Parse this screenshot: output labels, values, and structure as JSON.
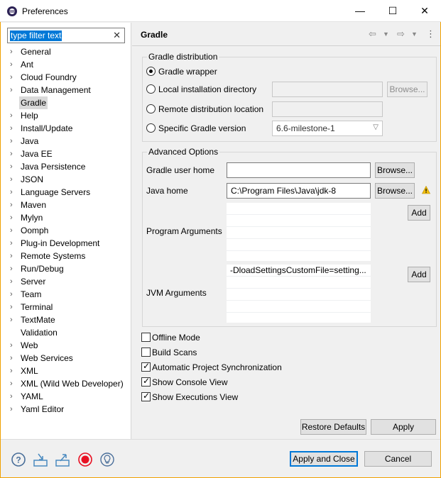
{
  "window": {
    "title": "Preferences",
    "min_glyph": "—",
    "max_glyph": "☐",
    "close_glyph": "✕"
  },
  "filter": {
    "value": "type filter text"
  },
  "tree": [
    {
      "label": "General",
      "expandable": true
    },
    {
      "label": "Ant",
      "expandable": true
    },
    {
      "label": "Cloud Foundry",
      "expandable": true
    },
    {
      "label": "Data Management",
      "expandable": true
    },
    {
      "label": "Gradle",
      "expandable": false,
      "selected": true
    },
    {
      "label": "Help",
      "expandable": true
    },
    {
      "label": "Install/Update",
      "expandable": true
    },
    {
      "label": "Java",
      "expandable": true
    },
    {
      "label": "Java EE",
      "expandable": true
    },
    {
      "label": "Java Persistence",
      "expandable": true
    },
    {
      "label": "JSON",
      "expandable": true
    },
    {
      "label": "Language Servers",
      "expandable": true
    },
    {
      "label": "Maven",
      "expandable": true
    },
    {
      "label": "Mylyn",
      "expandable": true
    },
    {
      "label": "Oomph",
      "expandable": true
    },
    {
      "label": "Plug-in Development",
      "expandable": true
    },
    {
      "label": "Remote Systems",
      "expandable": true
    },
    {
      "label": "Run/Debug",
      "expandable": true
    },
    {
      "label": "Server",
      "expandable": true
    },
    {
      "label": "Team",
      "expandable": true
    },
    {
      "label": "Terminal",
      "expandable": true
    },
    {
      "label": "TextMate",
      "expandable": true
    },
    {
      "label": "Validation",
      "expandable": false
    },
    {
      "label": "Web",
      "expandable": true
    },
    {
      "label": "Web Services",
      "expandable": true
    },
    {
      "label": "XML",
      "expandable": true
    },
    {
      "label": "XML (Wild Web Developer)",
      "expandable": true
    },
    {
      "label": "YAML",
      "expandable": true
    },
    {
      "label": "Yaml Editor",
      "expandable": true
    }
  ],
  "page": {
    "title": "Gradle",
    "distribution": {
      "title": "Gradle distribution",
      "options": [
        {
          "label": "Gradle wrapper",
          "selected": true
        },
        {
          "label": "Local installation directory",
          "selected": false
        },
        {
          "label": "Remote distribution location",
          "selected": false
        },
        {
          "label": "Specific Gradle version",
          "selected": false
        }
      ],
      "local_dir_value": "",
      "remote_value": "",
      "browse_label": "Browse...",
      "version_value": "6.6-milestone-1"
    },
    "advanced": {
      "title": "Advanced Options",
      "user_home_label": "Gradle user home",
      "user_home_value": "",
      "java_home_label": "Java home",
      "java_home_value": "C:\\Program Files\\Java\\jdk-8",
      "browse_label": "Browse...",
      "program_args_label": "Program Arguments",
      "program_args_rows": [
        "",
        "",
        "",
        ""
      ],
      "jvm_args_label": "JVM Arguments",
      "jvm_args_rows": [
        "-DloadSettingsCustomFile=setting...",
        "",
        "",
        ""
      ],
      "add_label": "Add"
    },
    "checkboxes": [
      {
        "label": "Offline Mode",
        "checked": false
      },
      {
        "label": "Build Scans",
        "checked": false
      },
      {
        "label": "Automatic Project Synchronization",
        "checked": true
      },
      {
        "label": "Show Console View",
        "checked": true
      },
      {
        "label": "Show Executions View",
        "checked": true
      }
    ],
    "restore_defaults_label": "Restore Defaults",
    "apply_label": "Apply"
  },
  "footer": {
    "apply_close_label": "Apply and Close",
    "cancel_label": "Cancel"
  },
  "colors": {
    "accent": "#0078d7",
    "window_border": "#f0a000",
    "record_red": "#e81123"
  }
}
